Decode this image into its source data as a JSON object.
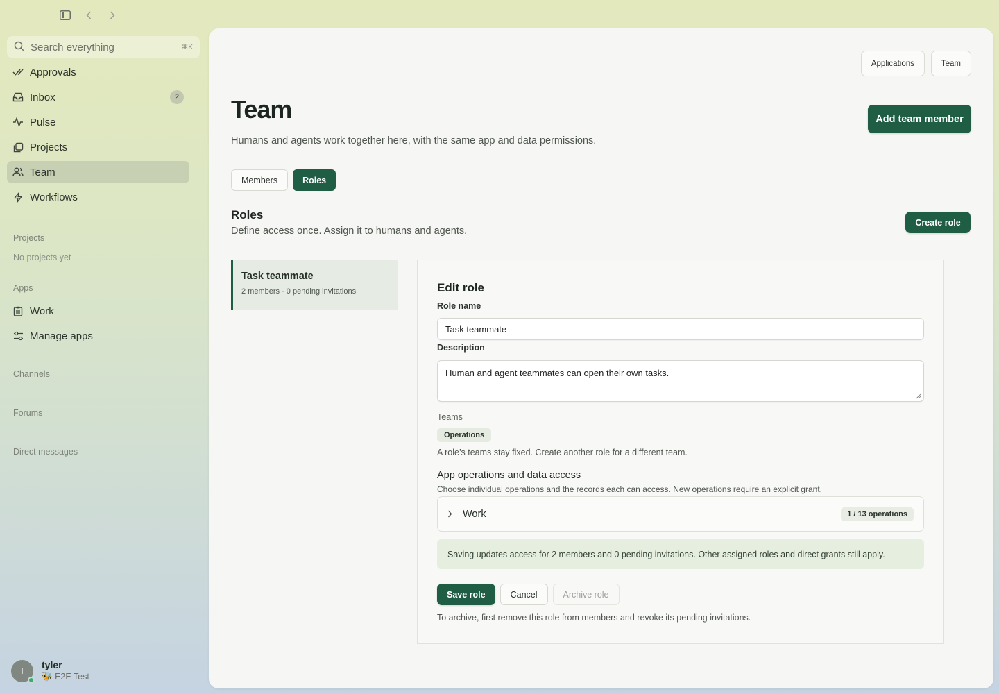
{
  "sidebar": {
    "search_placeholder": "Search everything",
    "search_shortcut": "⌘K",
    "nav": [
      {
        "label": "Approvals",
        "icon": "check-double-icon"
      },
      {
        "label": "Inbox",
        "icon": "inbox-icon",
        "badge": "2"
      },
      {
        "label": "Pulse",
        "icon": "pulse-icon"
      },
      {
        "label": "Projects",
        "icon": "projects-icon"
      },
      {
        "label": "Team",
        "icon": "people-icon",
        "active": true
      },
      {
        "label": "Workflows",
        "icon": "bolt-icon"
      }
    ],
    "projects_label": "Projects",
    "projects_empty": "No projects yet",
    "apps_label": "Apps",
    "apps": [
      {
        "label": "Work",
        "icon": "clipboard-icon"
      },
      {
        "label": "Manage apps",
        "icon": "sliders-icon"
      }
    ],
    "channels_label": "Channels",
    "forums_label": "Forums",
    "dm_label": "Direct messages"
  },
  "user": {
    "initial": "T",
    "name": "tyler",
    "org": "E2E Test"
  },
  "header": {
    "applications_label": "Applications",
    "team_label": "Team",
    "title": "Team",
    "subtitle": "Humans and agents work together here, with the same app and data permissions.",
    "add_member_label": "Add team member"
  },
  "tabs": {
    "members": "Members",
    "roles": "Roles"
  },
  "roles": {
    "heading": "Roles",
    "subheading": "Define access once. Assign it to humans and agents.",
    "create_label": "Create role",
    "list": [
      {
        "name": "Task teammate",
        "meta": "2 members · 0 pending invitations"
      }
    ]
  },
  "edit": {
    "title": "Edit role",
    "role_name_label": "Role name",
    "role_name_value": "Task teammate",
    "description_label": "Description",
    "description_value": "Human and agent teammates can open their own tasks.",
    "teams_label": "Teams",
    "team_chip": "Operations",
    "teams_hint": "A role’s teams stay fixed. Create another role for a different team.",
    "access_heading": "App operations and data access",
    "access_sub": "Choose individual operations and the records each can access. New operations require an explicit grant.",
    "app_name": "Work",
    "app_ops": "1 / 13 operations",
    "notice": "Saving updates access for 2 members and 0 pending invitations. Other assigned roles and direct grants still apply.",
    "save_label": "Save role",
    "cancel_label": "Cancel",
    "archive_label": "Archive role",
    "footer": "To archive, first remove this role from members and revoke its pending invitations."
  },
  "colors": {
    "accent": "#1f5e45"
  }
}
